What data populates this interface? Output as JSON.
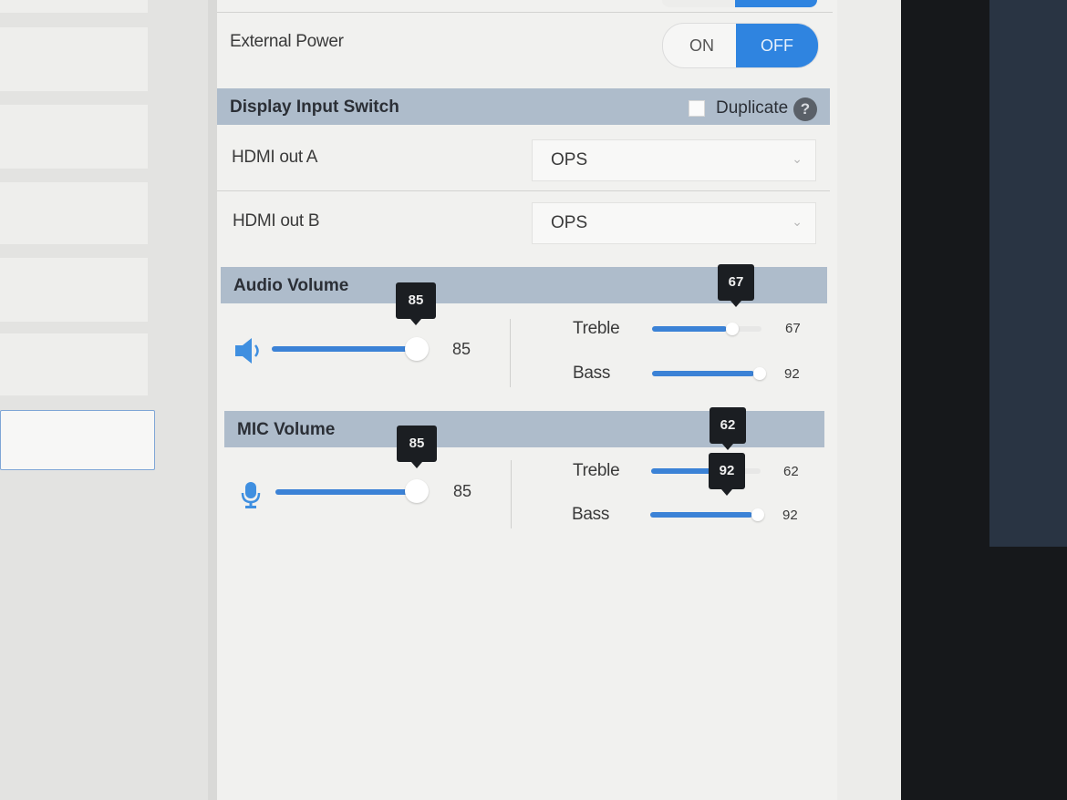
{
  "external_power": {
    "label": "External Power",
    "on_label": "ON",
    "off_label": "OFF",
    "selected": "OFF"
  },
  "display_input_switch": {
    "title": "Display Input Switch",
    "duplicate_label": "Duplicate",
    "duplicate_checked": false,
    "help_symbol": "?",
    "hdmi_out_a": {
      "label": "HDMI out A",
      "value": "OPS",
      "chevron": "⌄"
    },
    "hdmi_out_b": {
      "label": "HDMI out B",
      "value": "OPS",
      "chevron": "⌄"
    }
  },
  "audio_volume": {
    "title": "Audio Volume",
    "volume": {
      "value": 85,
      "value_text": "85",
      "tooltip": "85",
      "icon": "speaker-icon"
    },
    "treble": {
      "label": "Treble",
      "value": 67,
      "value_text": "67",
      "tooltip": "67"
    },
    "bass": {
      "label": "Bass",
      "value": 92,
      "value_text": "92"
    }
  },
  "mic_volume": {
    "title": "MIC Volume",
    "volume": {
      "value": 85,
      "value_text": "85",
      "tooltip": "85",
      "icon": "microphone-icon"
    },
    "treble": {
      "label": "Treble",
      "value": 62,
      "value_text": "62",
      "tooltip": "62"
    },
    "bass": {
      "label": "Bass",
      "value": 92,
      "value_text": "92",
      "tooltip": "92"
    }
  },
  "colors": {
    "accent": "#2f84e0",
    "section_bar": "#aebccb",
    "tooltip": "#1b1e22"
  }
}
